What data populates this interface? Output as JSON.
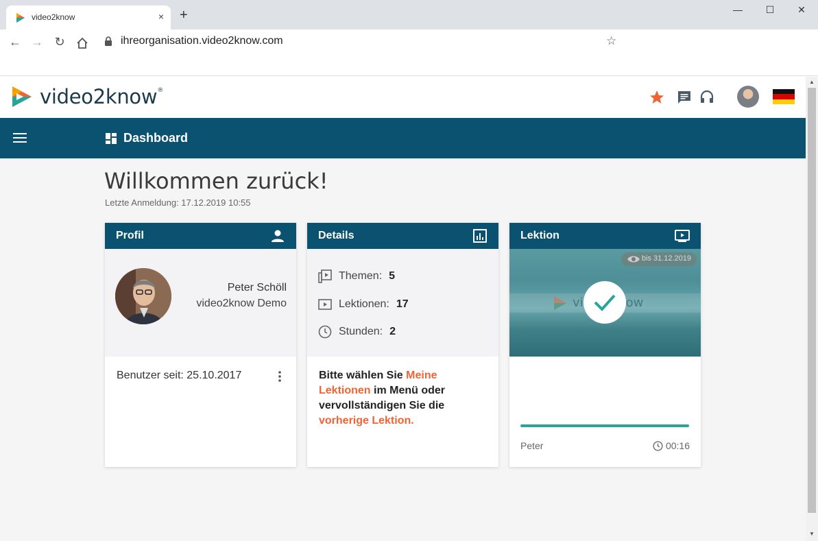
{
  "browser": {
    "tab_title": "video2know",
    "tab_close": "×",
    "new_tab": "+",
    "url": "ihreorganisation.video2know.com",
    "window_minimize": "—",
    "window_maximize": "☐",
    "window_close": "✕"
  },
  "header": {
    "logo_text": "video2know",
    "logo_reg": "®",
    "icons": [
      "star-icon",
      "chat-icon",
      "headset-icon"
    ],
    "accent_color": "#ef6434"
  },
  "nav": {
    "title": "Dashboard",
    "bar_color": "#0b5270"
  },
  "main": {
    "welcome": "Willkommen zurück!",
    "last_login": "Letzte Anmeldung: 17.12.2019 10:55"
  },
  "profile_card": {
    "title": "Profil",
    "name": "Peter Schöll",
    "org": "video2know Demo",
    "since": "Benutzer seit: 25.10.2017"
  },
  "details_card": {
    "title": "Details",
    "rows": [
      {
        "label": "Themen:",
        "value": "5"
      },
      {
        "label": "Lektionen:",
        "value": "17"
      },
      {
        "label": "Stunden:",
        "value": "2"
      }
    ],
    "text_1": "Bitte wählen Sie ",
    "link_1": "Meine Lektionen",
    "text_2": " im Menü oder vervollständigen Sie die ",
    "link_2": "vorherige Lektion."
  },
  "lesson_card": {
    "title": "Lektion",
    "badge": "bis 31.12.2019",
    "watermark": "ow",
    "progress": 1.0,
    "author": "Peter",
    "duration": "00:16"
  }
}
